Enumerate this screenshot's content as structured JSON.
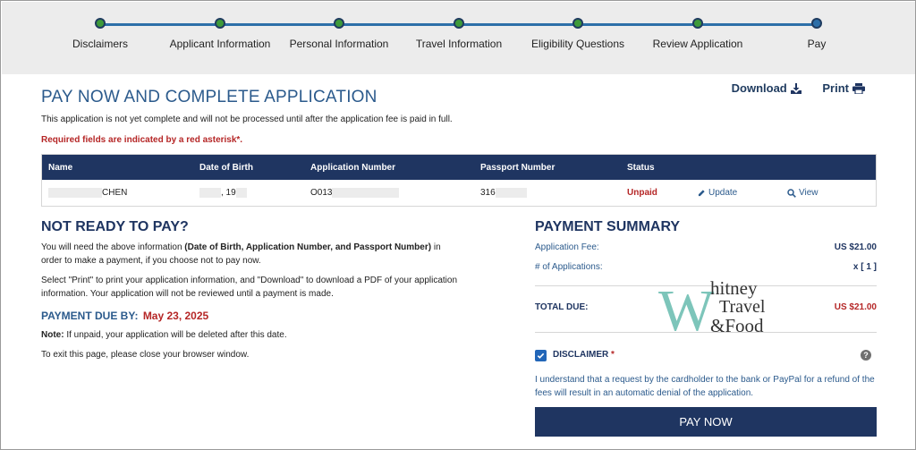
{
  "progress": {
    "steps": [
      {
        "label": "Disclaimers"
      },
      {
        "label": "Applicant Information"
      },
      {
        "label": "Personal Information"
      },
      {
        "label": "Travel Information"
      },
      {
        "label": "Eligibility Questions"
      },
      {
        "label": "Review Application"
      },
      {
        "label": "Pay"
      }
    ],
    "current_index": 6
  },
  "header": {
    "title": "PAY NOW AND COMPLETE APPLICATION",
    "download_label": "Download",
    "print_label": "Print",
    "note": "This application is not yet complete and will not be processed until after the application fee is paid in full.",
    "required_note": "Required fields are indicated by a red asterisk*."
  },
  "table": {
    "columns": [
      "Name",
      "Date of Birth",
      "Application Number",
      "Passport Number",
      "Status"
    ],
    "row": {
      "name_visible": "CHEN",
      "dob_visible": ", 19",
      "application_visible": "O013",
      "passport_visible": "316",
      "status": "Unpaid",
      "update_label": "Update",
      "view_label": "View"
    }
  },
  "not_ready": {
    "heading": "NOT READY TO PAY?",
    "para1_start": "You will need the above information ",
    "para1_bold": "(Date of Birth, Application Number, and Passport Number)",
    "para1_end": " in order to make a payment, if you choose not to pay now.",
    "para2": "Select \"Print\" to print your application information, and \"Download\" to download a PDF of your application information. Your application will not be reviewed until a payment is made.",
    "due_label": "PAYMENT DUE BY:",
    "due_date": "May 23, 2025",
    "note_label": "Note:",
    "note_text": " If unpaid, your application will be deleted after this date.",
    "exit_text": "To exit this page, please close your browser window."
  },
  "summary": {
    "heading": "PAYMENT SUMMARY",
    "fee_label": "Application Fee:",
    "fee_value": "US $21.00",
    "count_label": "# of Applications:",
    "count_value": "x [ 1 ]",
    "total_label": "TOTAL DUE:",
    "total_value": "US $21.00",
    "disclaimer_label": "DISCLAIMER",
    "disclaimer_asterisk": "*",
    "disclaimer_checked": true,
    "disclaimer_text": "I understand that a request by the cardholder to the bank or PayPal for a refund of the fees will result in an automatic denial of the application.",
    "help_icon": "?",
    "pay_button": "PAY NOW"
  },
  "watermark": {
    "big_letter": "W",
    "line1": "hitney",
    "line2": "Travel",
    "line3": "&Food"
  },
  "colors": {
    "navy": "#1f3561",
    "blue": "#2b5a8c",
    "red": "#b52626",
    "step_done": "#3e9a3a",
    "watermark_teal": "#6fbfb3"
  }
}
